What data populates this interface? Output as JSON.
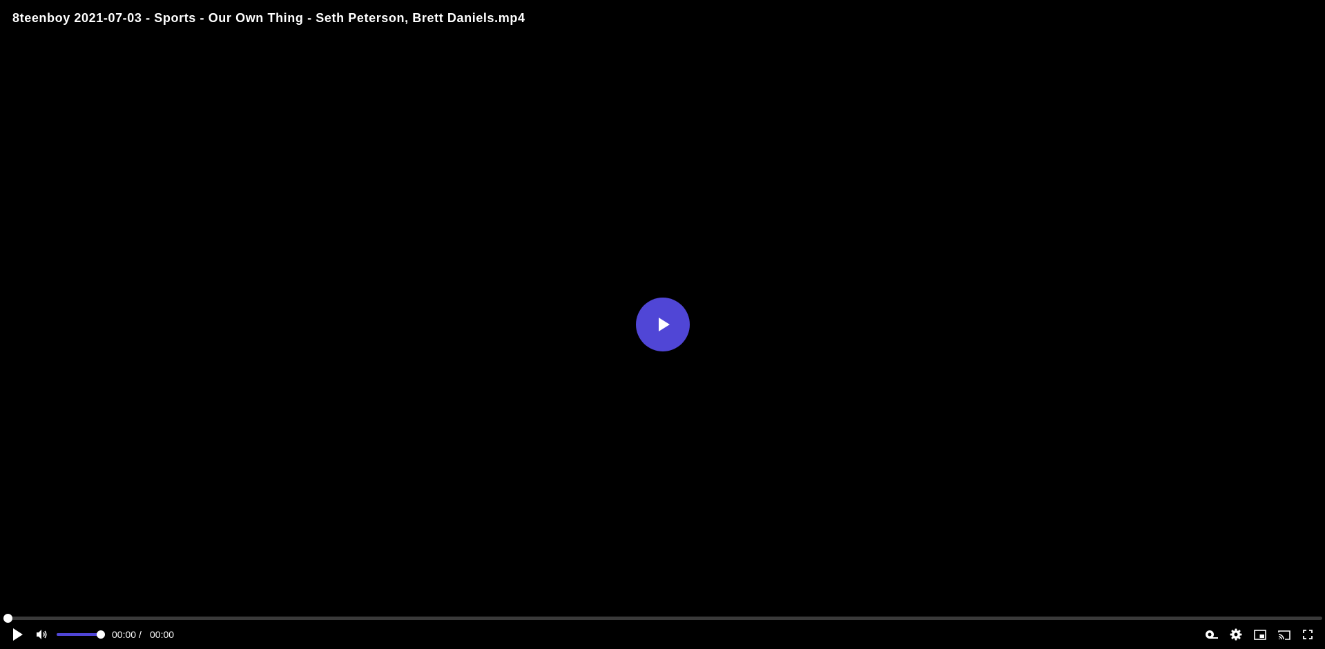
{
  "video": {
    "title": "8teenboy 2021-07-03 - Sports - Our Own Thing - Seth Peterson, Brett Daniels.mp4"
  },
  "playback": {
    "current_time": "00:00",
    "separator": "/",
    "duration": "00:00",
    "progress_fraction": 0,
    "volume_fraction": 1
  },
  "icons": {
    "big_play": "play-icon",
    "play": "play-icon",
    "volume": "volume-icon",
    "subtitles": "subtitles-icon",
    "settings": "gear-icon",
    "pip": "picture-in-picture-icon",
    "cast": "cast-icon",
    "fullscreen": "fullscreen-icon"
  },
  "colors": {
    "accent": "#5046d6",
    "background": "#000000",
    "track": "#3a3a3a",
    "foreground": "#ffffff"
  }
}
